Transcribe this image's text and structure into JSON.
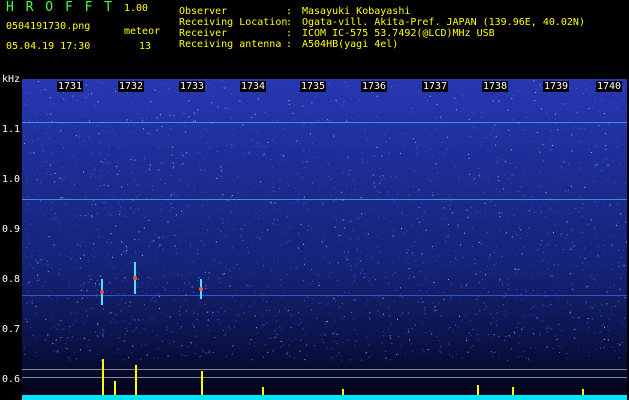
{
  "app": {
    "title": "H R O F F T",
    "version": "1.00",
    "filename": "0504191730.png",
    "datetime": "05.04.19 17:30",
    "mode_label": "meteor",
    "count": "13"
  },
  "info": {
    "rows": [
      {
        "label": "Observer",
        "value": "Masayuki Kobayashi"
      },
      {
        "label": "Receiving Location",
        "value": "Ogata-vill. Akita-Pref. JAPAN (139.96E, 40.02N)"
      },
      {
        "label": "Receiver",
        "value": "ICOM IC-575 53.7492(@LCD)MHz USB"
      },
      {
        "label": "Receiving antenna",
        "value": "A504HB(yagi 4el)"
      }
    ]
  },
  "axis": {
    "unit": "kHz",
    "y_ticks": [
      "1.1",
      "1.0",
      "0.9",
      "0.8",
      "0.7",
      "0.6"
    ],
    "x_ticks": [
      "1731",
      "1732",
      "1733",
      "1734",
      "1735",
      "1736",
      "1737",
      "1738",
      "1739",
      "1740"
    ]
  },
  "colors": {
    "background": "#000000",
    "spectrum": "#1b2fa0",
    "signal": "#ffff00",
    "baseline": "#00ffff",
    "title": "#44ff44"
  }
}
